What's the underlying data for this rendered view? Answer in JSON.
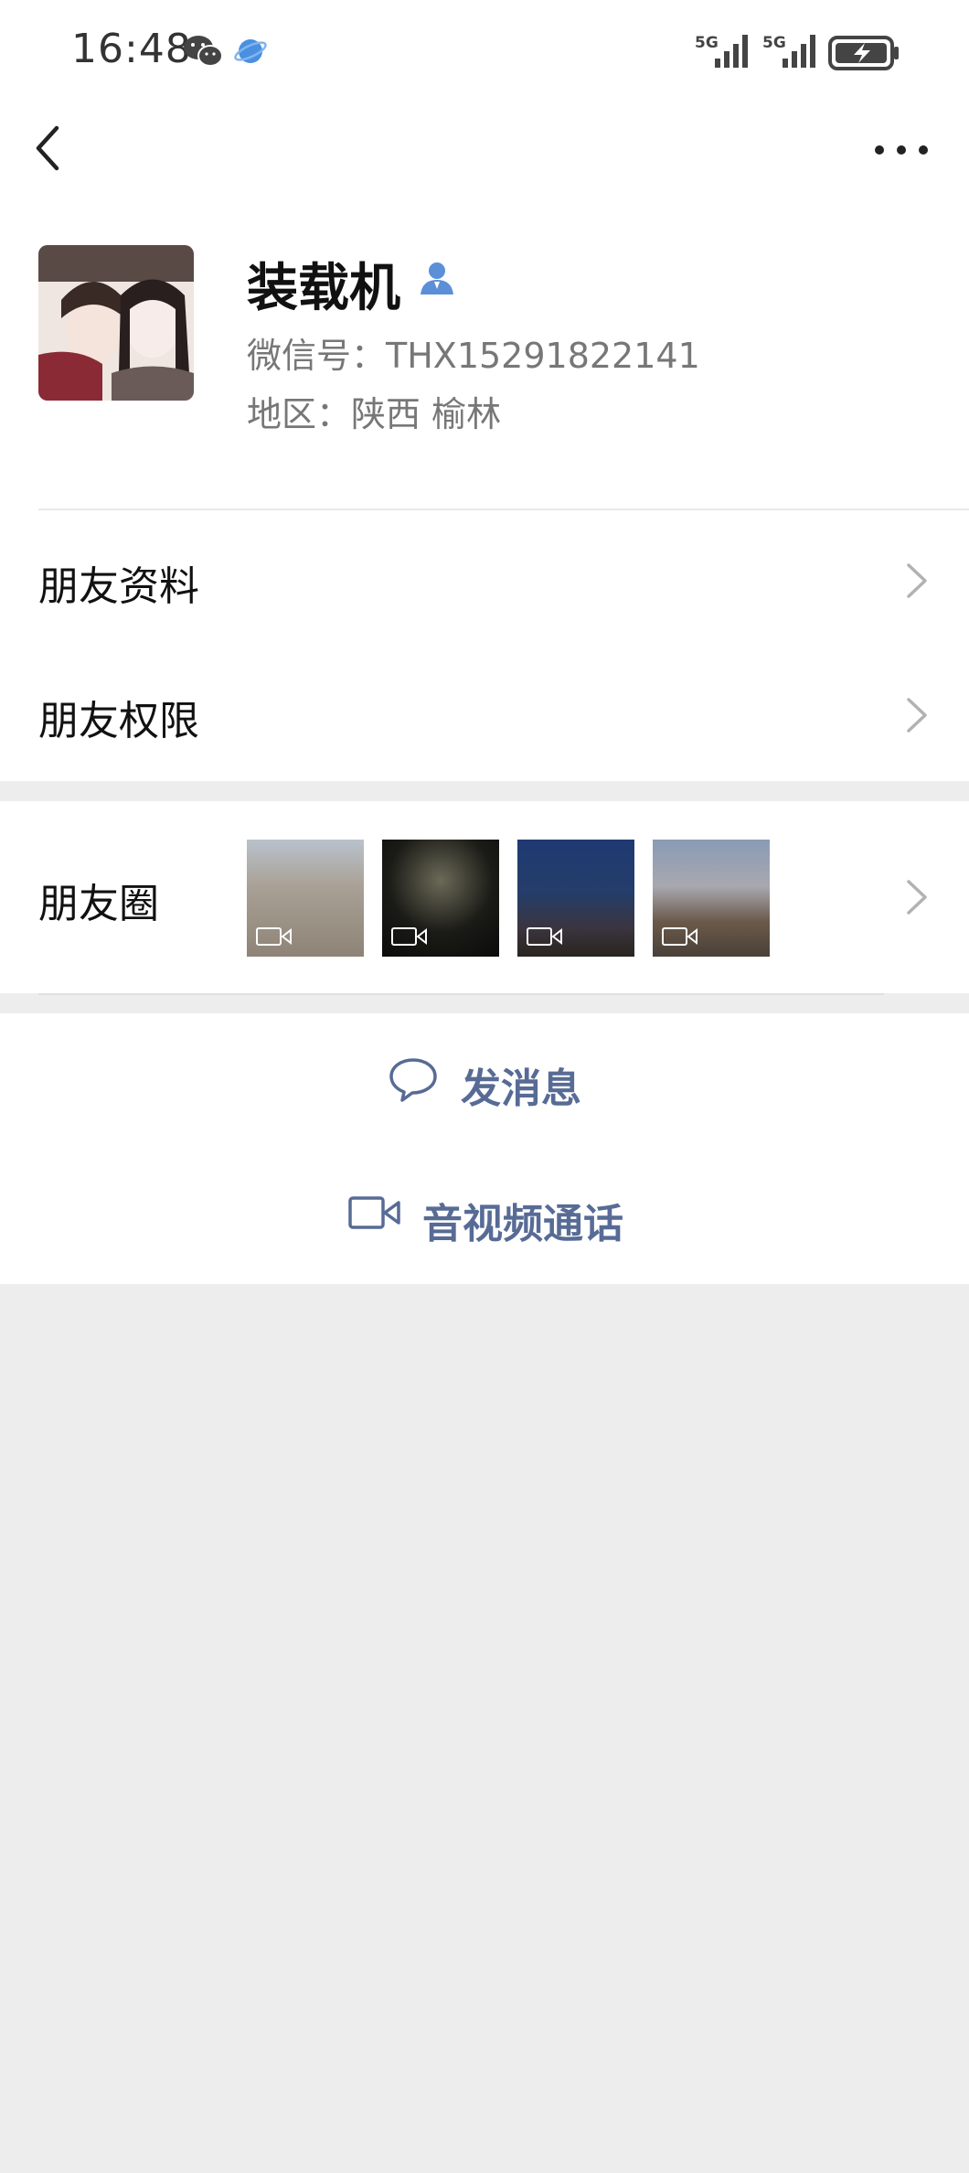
{
  "status_bar": {
    "time": "16:48",
    "icons": [
      "wechat-icon",
      "browser-icon",
      "signal-5g-icon",
      "signal-5g-icon",
      "battery-charging-icon"
    ]
  },
  "nav": {
    "back_icon": "chevron-left-icon",
    "more_icon": "more-dots-icon"
  },
  "profile": {
    "name": "装载机",
    "wechat_id": "微信号：THX15291822141",
    "region": "地区：陕西  榆林"
  },
  "menu": {
    "items": [
      {
        "label": "朋友资料"
      },
      {
        "label": "朋友权限"
      }
    ]
  },
  "moments": {
    "label": "朋友圈",
    "thumbnails": [
      {
        "kind": "video"
      },
      {
        "kind": "video"
      },
      {
        "kind": "video"
      },
      {
        "kind": "video"
      }
    ]
  },
  "actions": {
    "send_message": "发消息",
    "av_call": "音视频通话"
  },
  "colors": {
    "link": "#576b95",
    "background": "#ededed"
  }
}
